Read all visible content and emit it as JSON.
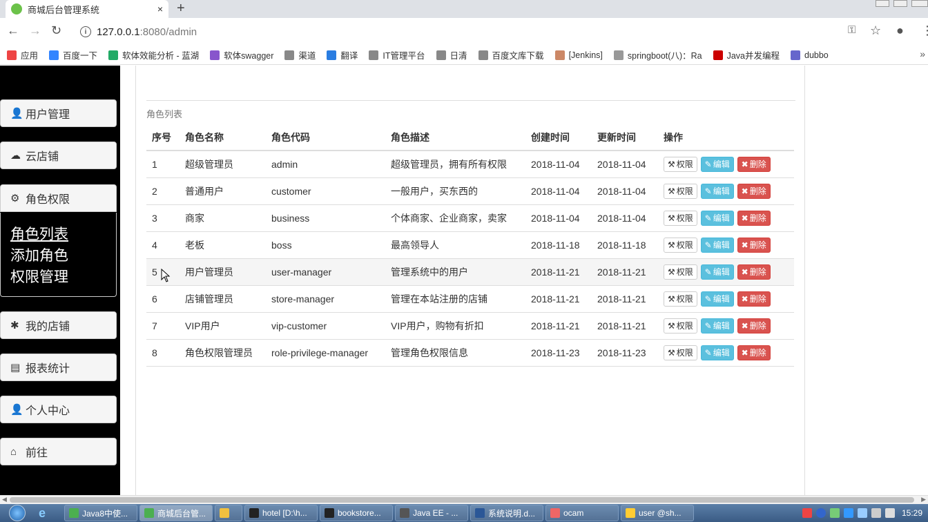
{
  "browser": {
    "tab_title": "商城后台管理系统",
    "tab_close": "×",
    "new_tab": "+",
    "url_host": "127.0.0.1",
    "url_rest": ":8080/admin"
  },
  "bookmarks": [
    {
      "label": "应用",
      "color": "#e44"
    },
    {
      "label": "百度一下",
      "color": "#3385ff"
    },
    {
      "label": "软体效能分析 - 蓝湖",
      "color": "#2a6"
    },
    {
      "label": "软体swagger",
      "color": "#85c"
    },
    {
      "label": "渠道",
      "color": "#888"
    },
    {
      "label": "翻译",
      "color": "#2a7de1"
    },
    {
      "label": "IT管理平台",
      "color": "#888"
    },
    {
      "label": "日清",
      "color": "#888"
    },
    {
      "label": "百度文库下载",
      "color": "#888"
    },
    {
      "label": "[Jenkins]",
      "color": "#c86"
    },
    {
      "label": "springboot(八)：Ra",
      "color": "#999"
    },
    {
      "label": "Java并发编程",
      "color": "#c00"
    },
    {
      "label": "dubbo",
      "color": "#66c"
    }
  ],
  "sidebar": {
    "menu": [
      {
        "label": "用户管理",
        "icon": "user-icon",
        "glyph": "👤"
      },
      {
        "label": "云店铺",
        "icon": "cloud-icon",
        "glyph": "☁"
      },
      {
        "label": "角色权限",
        "icon": "gear-icon",
        "glyph": "⚙"
      },
      {
        "label": "我的店铺",
        "icon": "asterisk-icon",
        "glyph": "✱"
      },
      {
        "label": "报表统计",
        "icon": "list-icon",
        "glyph": "▤"
      },
      {
        "label": "个人中心",
        "icon": "user-icon",
        "glyph": "👤"
      },
      {
        "label": "前往",
        "icon": "home-icon",
        "glyph": "⌂"
      }
    ],
    "submenu": [
      "角色列表",
      "添加角色",
      "权限管理"
    ]
  },
  "main": {
    "caption": "角色列表",
    "columns": [
      "序号",
      "角色名称",
      "角色代码",
      "角色描述",
      "创建时间",
      "更新时间",
      "操作"
    ],
    "rows": [
      [
        "1",
        "超级管理员",
        "admin",
        "超级管理员，拥有所有权限",
        "2018-11-04",
        "2018-11-04"
      ],
      [
        "2",
        "普通用户",
        "customer",
        "一般用户，买东西的",
        "2018-11-04",
        "2018-11-04"
      ],
      [
        "3",
        "商家",
        "business",
        "个体商家、企业商家，卖家",
        "2018-11-04",
        "2018-11-04"
      ],
      [
        "4",
        "老板",
        "boss",
        "最高领导人",
        "2018-11-18",
        "2018-11-18"
      ],
      [
        "5",
        "用户管理员",
        "user-manager",
        "管理系统中的用户",
        "2018-11-21",
        "2018-11-21"
      ],
      [
        "6",
        "店铺管理员",
        "store-manager",
        "管理在本站注册的店铺",
        "2018-11-21",
        "2018-11-21"
      ],
      [
        "7",
        "VIP用户",
        "vip-customer",
        "VIP用户，购物有折扣",
        "2018-11-21",
        "2018-11-21"
      ],
      [
        "8",
        "角色权限管理员",
        "role-privilege-manager",
        "管理角色权限信息",
        "2018-11-23",
        "2018-11-23"
      ]
    ],
    "actions": {
      "privilege": "权限",
      "edit": "编辑",
      "delete": "删除"
    }
  },
  "taskbar": {
    "apps": [
      {
        "label": "Java8中使...",
        "color": "#4caf50"
      },
      {
        "label": "商城后台管...",
        "color": "#4caf50",
        "active": true
      },
      {
        "label": "",
        "color": "#f0c040"
      },
      {
        "label": "hotel [D:\\h...",
        "color": "#222"
      },
      {
        "label": "bookstore...",
        "color": "#222"
      },
      {
        "label": "Java EE - ...",
        "color": "#555"
      },
      {
        "label": "系统说明.d...",
        "color": "#2b5797"
      },
      {
        "label": "ocam",
        "color": "#e66"
      },
      {
        "label": "user @sh...",
        "color": "#fc3"
      }
    ],
    "clock": "15:29"
  }
}
